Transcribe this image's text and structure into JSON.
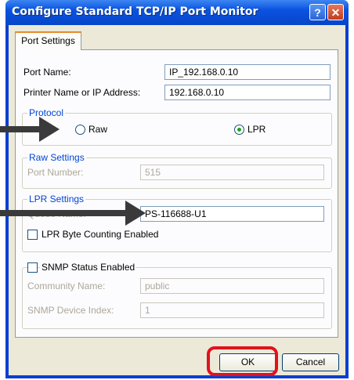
{
  "window": {
    "title": "Configure Standard TCP/IP Port Monitor",
    "help_glyph": "?",
    "close_glyph": "✕"
  },
  "tab": {
    "label": "Port Settings"
  },
  "port_name": {
    "label": "Port Name:",
    "value": "IP_192.168.0.10"
  },
  "printer_address": {
    "label": "Printer Name or IP Address:",
    "value": "192.168.0.10"
  },
  "protocol": {
    "label": "Protocol",
    "raw": "Raw",
    "lpr": "LPR",
    "selected": "LPR"
  },
  "raw_settings": {
    "label": "Raw Settings",
    "port_number_label": "Port Number:",
    "port_number": "515"
  },
  "lpr_settings": {
    "label": "LPR Settings",
    "queue_name_label": "Queue Name:",
    "queue_name": "PS-116688-U1",
    "byte_counting_label": "LPR Byte Counting Enabled",
    "byte_counting_checked": false
  },
  "snmp": {
    "label": "SNMP Status Enabled",
    "checked": false,
    "community_label": "Community Name:",
    "community_value": "public",
    "device_index_label": "SNMP Device Index:",
    "device_index_value": "1"
  },
  "buttons": {
    "ok": "OK",
    "cancel": "Cancel"
  },
  "colors": {
    "titlebar": "#0a52e0",
    "client": "#ece9d8",
    "highlight": "#e3111d",
    "group_label": "#0046d5"
  }
}
